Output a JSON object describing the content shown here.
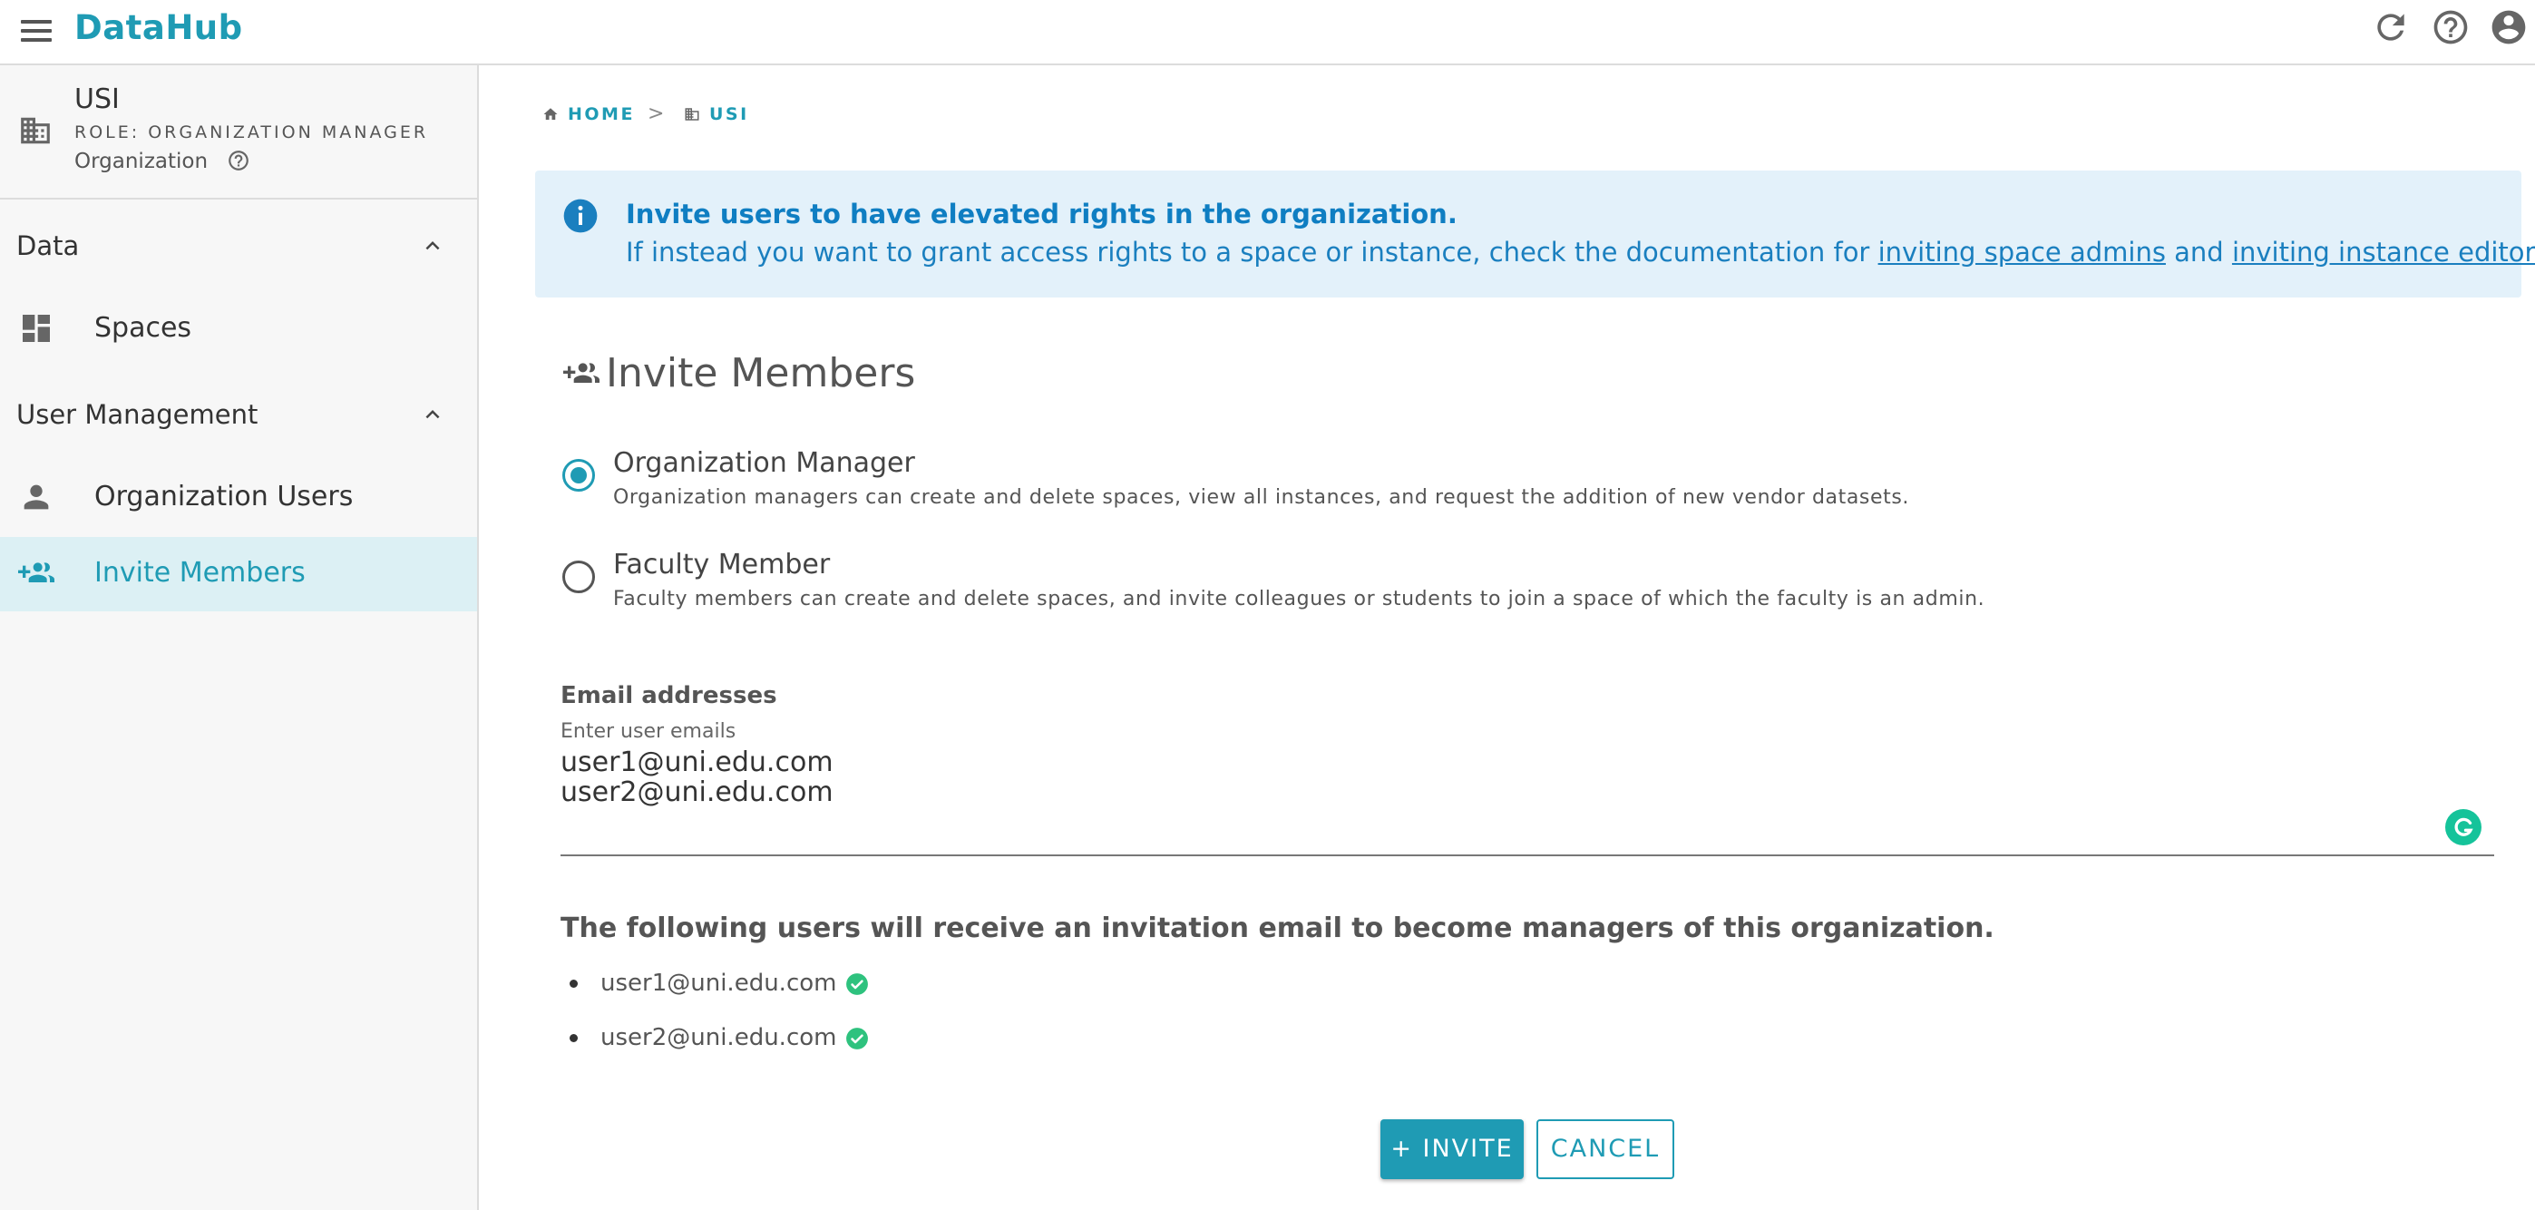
{
  "app": {
    "title": "DataHub"
  },
  "colors": {
    "accent": "#1f9bb4",
    "info_bg": "#e3f1fa",
    "info_text": "#0f7ec2",
    "success": "#2ec27e"
  },
  "header": {
    "icons": [
      "refresh-icon",
      "help-icon",
      "account-icon"
    ]
  },
  "sidebar": {
    "org": {
      "name": "USI",
      "role": "ROLE: ORGANIZATION MANAGER",
      "type": "Organization"
    },
    "sections": [
      {
        "label": "Data",
        "items": [
          {
            "label": "Spaces",
            "icon": "dashboard-icon",
            "active": false
          }
        ]
      },
      {
        "label": "User Management",
        "items": [
          {
            "label": "Organization Users",
            "icon": "person-icon",
            "active": false
          },
          {
            "label": "Invite Members",
            "icon": "group-add-icon",
            "active": true
          }
        ]
      }
    ]
  },
  "breadcrumb": [
    {
      "label": "HOME",
      "icon": "home-icon"
    },
    {
      "label": "USI",
      "icon": "building-icon"
    }
  ],
  "breadcrumb_separator": ">",
  "info": {
    "title": "Invite users to have elevated rights in the organization.",
    "body_prefix": "If instead you want to grant access rights to a space or instance, check the documentation for ",
    "link1": "inviting space admins",
    "body_mid": " and ",
    "link2": "inviting instance editors",
    "body_suffix": "."
  },
  "page": {
    "title": "Invite Members"
  },
  "roles": [
    {
      "title": "Organization Manager",
      "description": "Organization managers can create and delete spaces, view all instances, and request the addition of new vendor datasets.",
      "selected": true
    },
    {
      "title": "Faculty Member",
      "description": "Faculty members can create and delete spaces, and invite colleagues or students to join a space of which the faculty is an admin.",
      "selected": false
    }
  ],
  "emails": {
    "label": "Email addresses",
    "placeholder": "Enter user emails",
    "value": "user1@uni.edu.com\nuser2@uni.edu.com"
  },
  "summary": {
    "title": "The following users will receive an invitation email to become managers of this organization.",
    "users": [
      "user1@uni.edu.com",
      "user2@uni.edu.com"
    ]
  },
  "actions": {
    "invite": "+ INVITE",
    "cancel": "CANCEL"
  }
}
